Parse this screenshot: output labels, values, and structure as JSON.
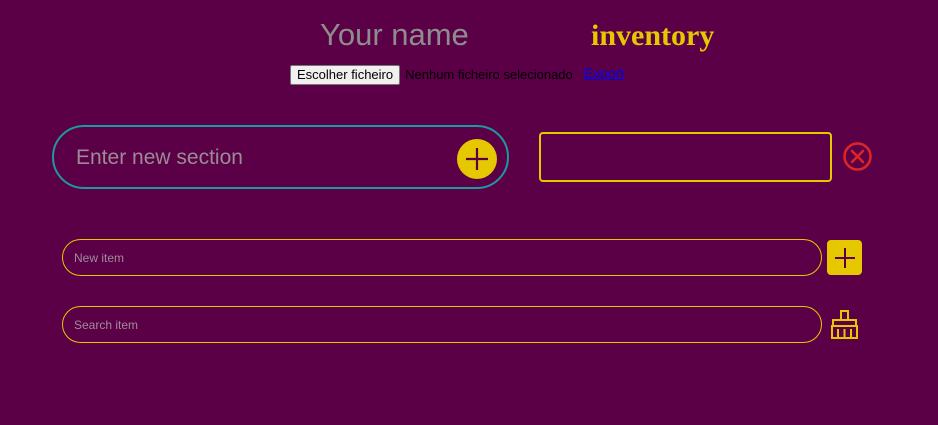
{
  "header": {
    "name_placeholder": "Your name",
    "title": "inventory"
  },
  "file": {
    "button_label": "Escolher ficheiro",
    "status": "Nenhum ficheiro selecionado",
    "export_label": "Export"
  },
  "section": {
    "placeholder": "Enter new section",
    "add_icon": "plus-icon"
  },
  "close_icon": "close-circle-icon",
  "items": {
    "new_placeholder": "New item",
    "search_placeholder": "Search item",
    "add_icon": "plus-icon",
    "clear_icon": "broom-icon"
  },
  "colors": {
    "background": "#5b0047",
    "accent": "#e6c800",
    "section_border": "#1b9aa0",
    "close": "#e02424",
    "link": "#0000ee"
  }
}
